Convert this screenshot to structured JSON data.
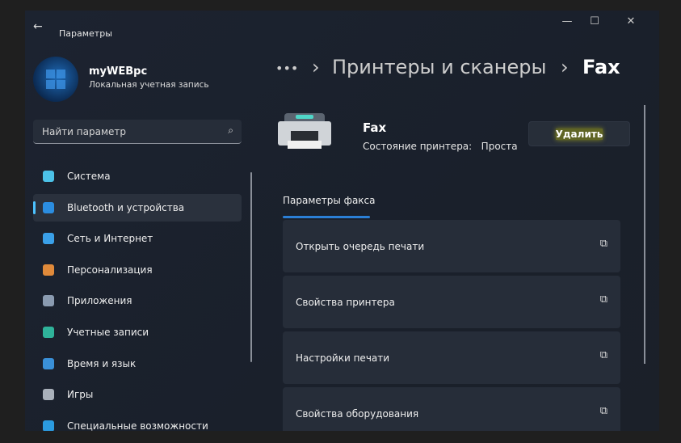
{
  "window": {
    "title": "Параметры",
    "back": "←",
    "minimize": "—",
    "maximize": "☐",
    "close": "✕"
  },
  "user": {
    "name": "myWEBpc",
    "account": "Локальная учетная запись"
  },
  "search": {
    "placeholder": "Найти параметр",
    "icon": "⌕"
  },
  "nav": [
    {
      "label": "Система",
      "color": "#4cc2e8"
    },
    {
      "label": "Bluetooth и устройства",
      "color": "#2b8de0",
      "selected": true
    },
    {
      "label": "Сеть и Интернет",
      "color": "#3aa0e8"
    },
    {
      "label": "Персонализация",
      "color": "#e08a3a"
    },
    {
      "label": "Приложения",
      "color": "#8a9bb0"
    },
    {
      "label": "Учетные записи",
      "color": "#2fb39a"
    },
    {
      "label": "Время и язык",
      "color": "#3a90d8"
    },
    {
      "label": "Игры",
      "color": "#a9b0ba"
    },
    {
      "label": "Специальные возможности",
      "color": "#2b9be0"
    }
  ],
  "breadcrumb": {
    "more": "•••",
    "sep": "›",
    "parent": "Принтеры и сканеры",
    "current": "Fax"
  },
  "device": {
    "name": "Fax",
    "status_label": "Состояние принтера:",
    "status_value": "Проста",
    "delete": "Удалить"
  },
  "tab": "Параметры факса",
  "cards": [
    {
      "label": "Открыть очередь печати"
    },
    {
      "label": "Свойства принтера"
    },
    {
      "label": "Настройки печати"
    },
    {
      "label": "Свойства оборудования"
    }
  ],
  "ext_icon": "⧉"
}
